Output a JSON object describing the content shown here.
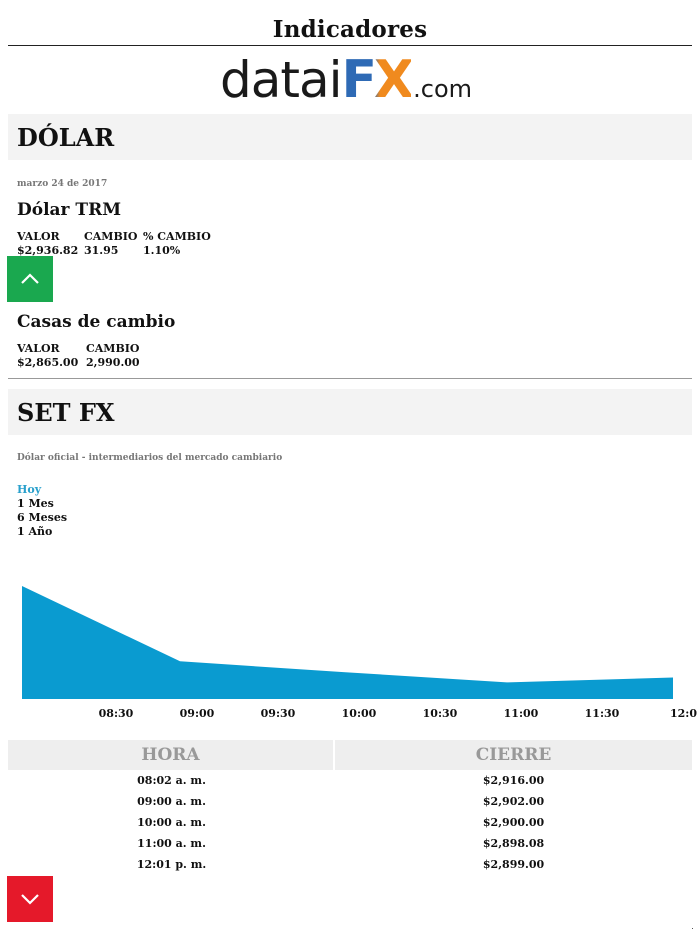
{
  "page": {
    "title": "Indicadores"
  },
  "logo": {
    "part1": "datai",
    "part2": "FX",
    "part3": ".com"
  },
  "dolar": {
    "section_title": "DÓLAR",
    "date": "marzo 24 de 2017",
    "trm": {
      "title": "Dólar TRM",
      "labels": {
        "valor": "VALOR",
        "cambio": "CAMBIO",
        "pct": "% CAMBIO"
      },
      "values": {
        "valor": "$2,936.82",
        "cambio": "31.95",
        "pct": "1.10%"
      }
    },
    "casas": {
      "title": "Casas de cambio",
      "labels": {
        "valor": "VALOR",
        "cambio": "CAMBIO"
      },
      "values": {
        "valor": "$2,865.00",
        "cambio": "2,990.00"
      }
    }
  },
  "setfx": {
    "section_title": "SET FX",
    "subtitle": "Dólar oficial - intermediarios del mercado cambiario",
    "ranges": [
      "Hoy",
      "1 Mes",
      "6 Meses",
      "1 Año"
    ],
    "active_range": "Hoy"
  },
  "chart_data": {
    "type": "area",
    "x": [
      "08:02",
      "09:00",
      "10:00",
      "11:00",
      "12:01"
    ],
    "values": [
      2916.0,
      2902.0,
      2900.0,
      2898.08,
      2899.0
    ],
    "x_ticks": [
      "08:30",
      "09:00",
      "09:30",
      "10:00",
      "10:30",
      "11:00",
      "11:30",
      "12:0"
    ],
    "bold_ticks": [
      "09:00",
      "10:00",
      "11:00",
      "12:0"
    ],
    "x_range_minutes": [
      "08:02",
      "12:01"
    ],
    "y_baseline": 2895.0,
    "fill_color": "#0a9bd0",
    "grid": false,
    "legend": "none"
  },
  "table": {
    "headers": [
      "HORA",
      "CIERRE"
    ],
    "rows": [
      [
        "08:02 a. m.",
        "$2,916.00"
      ],
      [
        "09:00 a. m.",
        "$2,902.00"
      ],
      [
        "10:00 a. m.",
        "$2,900.00"
      ],
      [
        "11:00 a. m.",
        "$2,898.08"
      ],
      [
        "12:01 p. m.",
        "$2,899.00"
      ]
    ]
  },
  "buttons": {
    "up_icon": "chevron-up-icon",
    "down_icon": "chevron-down-icon"
  },
  "colors": {
    "up_button": "#1aa84f",
    "down_button": "#e5192a",
    "active_range": "#29a0cc"
  }
}
